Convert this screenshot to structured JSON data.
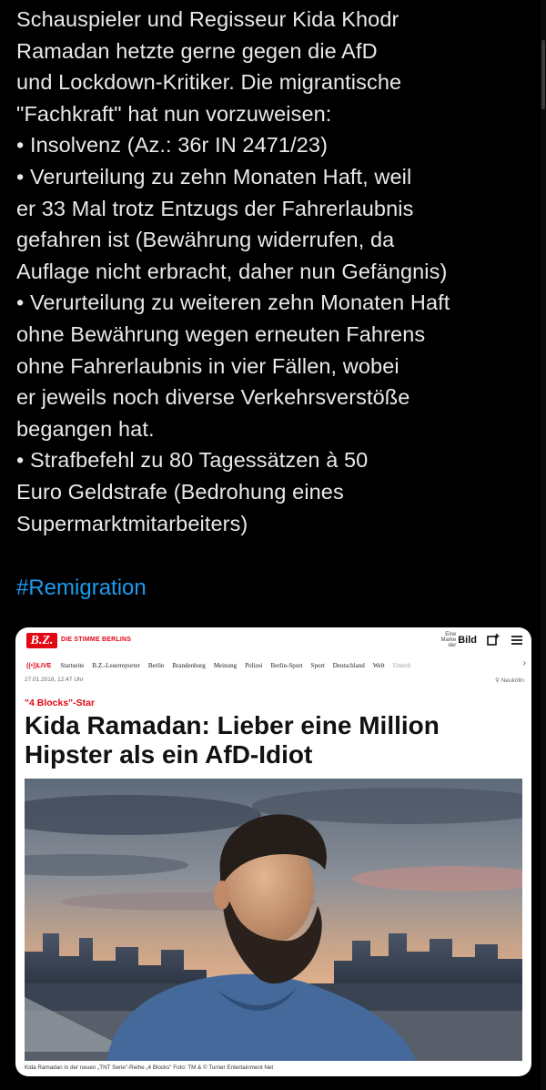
{
  "tweet": {
    "lines": [
      "Schauspieler und Regisseur Kida Khodr",
      "Ramadan hetzte gerne gegen die AfD",
      "und Lockdown-Kritiker. Die migrantische",
      "\"Fachkraft\" hat nun vorzuweisen:",
      "• Insolvenz (Az.: 36r IN 2471/23)",
      "• Verurteilung zu zehn Monaten Haft, weil",
      "er 33 Mal trotz Entzugs der Fahrerlaubnis",
      "gefahren ist (Bewährung widerrufen, da",
      "Auflage nicht erbracht, daher nun Gefängnis)",
      "• Verurteilung zu weiteren zehn Monaten Haft",
      "ohne Bewährung  wegen erneuten Fahrens",
      "ohne Fahrerlaubnis in vier Fällen, wobei",
      "er jeweils noch diverse Verkehrsverstöße",
      "begangen hat.",
      "• Strafbefehl zu 80 Tagessätzen à 50",
      "Euro Geldstrafe (Bedrohung eines",
      "Supermarktmitarbeiters)"
    ],
    "hashtag": "#Remigration"
  },
  "card": {
    "logo": "B.Z.",
    "tagline": "DIE STIMME BERLINS",
    "bild_badge_small": "Eine Marke der",
    "bild_logo": "Bild",
    "live_label": "LIVE",
    "nav": [
      "Startseite",
      "B.Z.-Leserreporter",
      "Berlin",
      "Brandenburg",
      "Meinung",
      "Polizei",
      "Berlin-Sport",
      "Sport",
      "Deutschland",
      "Welt",
      "Unterh"
    ],
    "date": "27.01.2018, 12:47 Uhr",
    "location": "Neukölln",
    "kicker": "\"4 Blocks\"-Star",
    "headline_line1": "Kida Ramadan: Lieber eine Million",
    "headline_line2": "Hipster als ein AfD-Idiot",
    "caption": "Kida Ramadan in der neuen „TNT Serie\"-Reihe „4 Blocks\" Foto: TM & © Turner Entertainment Net"
  },
  "colors": {
    "background": "#000000",
    "text": "#e7e9ea",
    "hashtag": "#1d9bf0",
    "bz_red": "#e30613"
  },
  "icons": [
    "bookmark-plus-icon",
    "menu-icon",
    "chevron-right-icon",
    "location-pin-icon"
  ]
}
